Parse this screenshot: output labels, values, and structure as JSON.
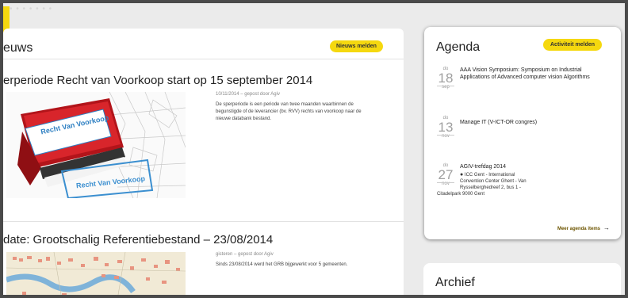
{
  "top_bar": {
    "dots": "• • • • • • •"
  },
  "news": {
    "title": "euws",
    "report_button": "Nieuws melden",
    "articles": [
      {
        "title": "erperiode Recht van Voorkoop start op 15 september 2014",
        "meta": "10/11/2014 – gepost door Agiv",
        "body": "De sperperiode is een periode van twee maanden waarbinnen de begunstigde of de leverancier (bv. RVV) rechts van voorkoop naar de nieuwe databank bestand.",
        "image": {
          "stamp_top": "Recht Van Voorkoop",
          "stamp_bottom": "Recht Van Voorkoop"
        }
      },
      {
        "title": "date: Grootschalig Referentiebestand – 23/08/2014",
        "meta": "gisteren – gepost door Agiv",
        "body": "Sinds 23/08/2014 werd het GRB bijgewerkt voor 5 gemeenten."
      }
    ]
  },
  "agenda": {
    "title": "Agenda",
    "report_button": "Activiteit melden",
    "events": [
      {
        "dow": "do",
        "day": "18",
        "month": "sep",
        "title": "AAA Vision Symposium: Symposium on Industrial Applications of Advanced computer vision Algorithms"
      },
      {
        "dow": "do",
        "day": "13",
        "month": "nov",
        "title": "Manage IT (V-ICT-OR congres)"
      },
      {
        "dow": "do",
        "day": "27",
        "month": "nov",
        "title": "AGIV-trefdag 2014",
        "location_lines": [
          "ICC Gent - International",
          "Convention Center Ghent - Van",
          "Rysselberghedreef 2, bus 1 -",
          "Citadelpark 9000 Gent"
        ]
      }
    ],
    "more_link": "Meer agenda items",
    "more_arrow": "→"
  },
  "archief": {
    "title": "Archief"
  },
  "colors": {
    "accent": "#f5d80f",
    "link": "#6d5500"
  }
}
